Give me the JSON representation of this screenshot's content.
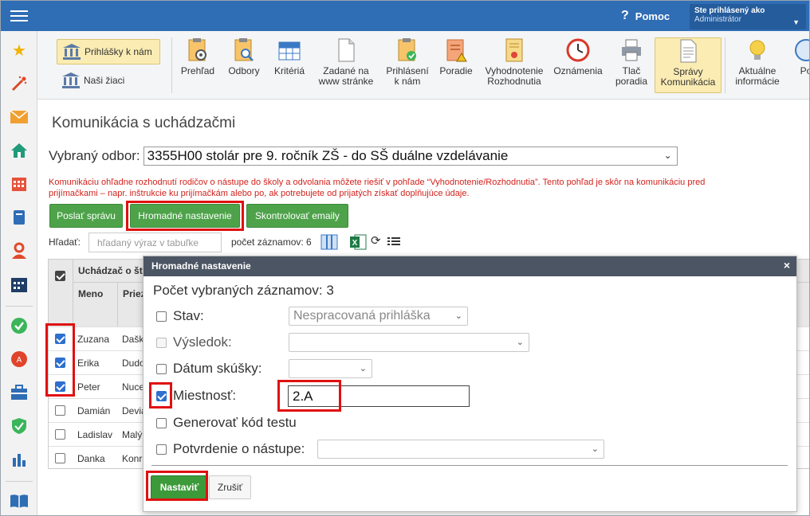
{
  "topbar": {
    "help_label": "Pomoc",
    "help_icon": "?",
    "user_line1": "Ste prihlásený ako",
    "user_line2": "Administrátor"
  },
  "sidebar": {
    "icons": [
      "star-icon",
      "wand-icon",
      "mail-icon",
      "home-icon",
      "calendar-icon",
      "book-icon",
      "user-icon",
      "schedule-icon",
      "check-icon",
      "badge-icon",
      "briefcase-icon",
      "shield-icon",
      "chart-icon",
      "open-book-icon"
    ]
  },
  "toolbar": {
    "left_buttons": [
      {
        "label": "Prihlášky k nám",
        "active": true
      },
      {
        "label": "Naši žiaci",
        "active": false
      }
    ],
    "items": [
      {
        "label": "Prehľad",
        "label2": ""
      },
      {
        "label": "Odbory",
        "label2": ""
      },
      {
        "label": "Kritériá",
        "label2": ""
      },
      {
        "label": "Zadané na",
        "label2": "www stránke"
      },
      {
        "label": "Prihlásení",
        "label2": "k nám"
      },
      {
        "label": "Poradie",
        "label2": ""
      },
      {
        "label": "Vyhodnotenie",
        "label2": "Rozhodnutia"
      },
      {
        "label": "Oznámenia",
        "label2": ""
      },
      {
        "label": "Tlač",
        "label2": "poradia"
      },
      {
        "label": "Správy",
        "label2": "Komunikácia"
      },
      {
        "label": "Aktuálne",
        "label2": "informácie"
      },
      {
        "label": "Po",
        "label2": ""
      }
    ]
  },
  "main": {
    "title": "Komunikácia s uchádzačmi",
    "odbor_label": "Vybraný odbor:",
    "odbor_value": "3355H00 stolár pre 9. ročník ZŠ - do SŠ duálne vzdelávanie",
    "warning_line1": "Komunikáciu ohľadne rozhodnutí rodičov o nástupe do školy a odvolania môžete riešiť v pohľade “Vyhodnotenie/Rozhodnutia”. Tento pohľad je skôr na komunikáciu pred",
    "warning_line2": "prijímačkami – napr. inštrukcie ku prijímačkám alebo po, ak potrebujete od prijatých získať doplňujúce údaje.",
    "buttons": {
      "send": "Poslať správu",
      "bulk": "Hromadné nastavenie",
      "check_emails": "Skontrolovať emaily"
    },
    "search_label": "Hľadať:",
    "search_placeholder": "hľadaný výraz v tabuľke",
    "count_label": "počet záznamov: 6"
  },
  "table": {
    "group_header": "Uchádzač o št",
    "col_meno": "Meno",
    "col_priez": "Priez",
    "rows": [
      {
        "meno": "Zuzana",
        "priez": "Dašk",
        "checked": true
      },
      {
        "meno": "Erika",
        "priez": "Dudo",
        "checked": true
      },
      {
        "meno": "Peter",
        "priez": "Nuce",
        "checked": true
      },
      {
        "meno": "Damián",
        "priez": "Devia",
        "checked": false
      },
      {
        "meno": "Ladislav",
        "priez": "Malý",
        "checked": false
      },
      {
        "meno": "Danka",
        "priez": "Konr",
        "checked": false
      }
    ]
  },
  "modal": {
    "title": "Hromadné nastavenie",
    "close": "×",
    "count": "Počet vybraných záznamov: 3",
    "fields": {
      "stav_label": "Stav:",
      "stav_value": "Nespracovaná prihláška",
      "vysledok_label": "Výsledok:",
      "datum_label": "Dátum skúšky:",
      "miestnost_label": "Miestnosť:",
      "miestnost_value": "2.A",
      "generovat_label": "Generovať kód testu",
      "potvrdenie_label": "Potvrdenie o nástupe:"
    },
    "btn_ok": "Nastaviť",
    "btn_cancel": "Zrušiť"
  },
  "colors": {
    "topbar": "#2f6db5",
    "green": "#4ea34a",
    "highlight": "#e01010",
    "warning": "#d2221c"
  }
}
